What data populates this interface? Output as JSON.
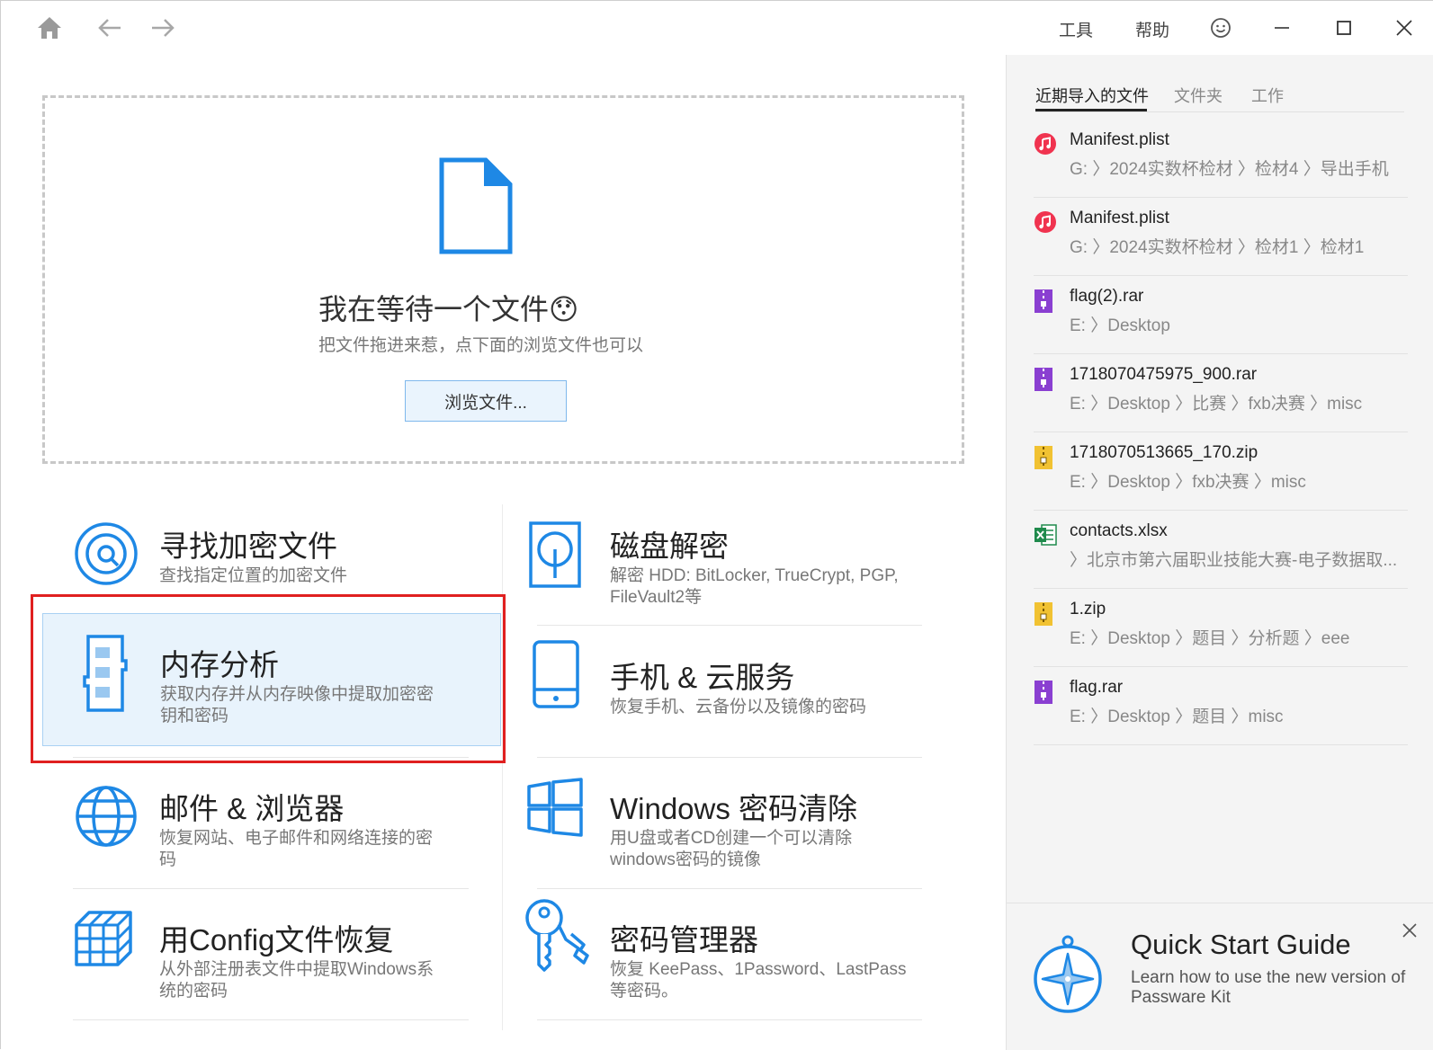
{
  "titlebar": {
    "menu_tools": "工具",
    "menu_help": "帮助"
  },
  "dropzone": {
    "title": "我在等待一个文件😯",
    "subtitle": "把文件拖进来惹，点下面的浏览文件也可以",
    "browse_button": "浏览文件..."
  },
  "tiles": [
    {
      "title": "寻找加密文件",
      "desc": "查找指定位置的加密文件",
      "icon": "disc-search-icon"
    },
    {
      "title": "磁盘解密",
      "desc": "解密 HDD: BitLocker, TrueCrypt, PGP, FileVault2等",
      "icon": "disk-icon"
    },
    {
      "title": "内存分析",
      "desc": "获取内存并从内存映像中提取加密密钥和密码",
      "icon": "memory-icon",
      "selected": true
    },
    {
      "title": "手机 & 云服务",
      "desc": "恢复手机、云备份以及镜像的密码",
      "icon": "phone-icon"
    },
    {
      "title": "邮件 & 浏览器",
      "desc": "恢复网站、电子邮件和网络连接的密码",
      "icon": "globe-icon"
    },
    {
      "title": "Windows 密码清除",
      "desc": "用U盘或者CD创建一个可以清除windows密码的镜像",
      "icon": "windows-icon"
    },
    {
      "title": "用Config文件恢复",
      "desc": "从外部注册表文件中提取Windows系统的密码",
      "icon": "cubes-icon"
    },
    {
      "title": "密码管理器",
      "desc": "恢复 KeePass、1Password、LastPass 等密码。",
      "icon": "keys-icon"
    }
  ],
  "sidebar": {
    "tabs": [
      "近期导入的文件",
      "文件夹",
      "工作"
    ],
    "files": [
      {
        "name": "Manifest.plist",
        "path": "G: 〉2024实数杯检材 〉检材4 〉导出手机",
        "icon": "music-icon",
        "color": "#f0334f"
      },
      {
        "name": "Manifest.plist",
        "path": "G: 〉2024实数杯检材 〉检材1 〉检材1",
        "icon": "music-icon",
        "color": "#f0334f"
      },
      {
        "name": "flag(2).rar",
        "path": "E: 〉Desktop",
        "icon": "rar-icon",
        "color": "#8a3fd1"
      },
      {
        "name": "1718070475975_900.rar",
        "path": "E: 〉Desktop 〉比赛 〉fxb决赛 〉misc",
        "icon": "rar-icon",
        "color": "#8a3fd1"
      },
      {
        "name": "1718070513665_170.zip",
        "path": "E: 〉Desktop 〉fxb决赛 〉misc",
        "icon": "zip-icon",
        "color": "#f1c232"
      },
      {
        "name": "contacts.xlsx",
        "path": "〉北京市第六届职业技能大赛-电子数据取...",
        "icon": "excel-icon",
        "color": "#1f8a4c"
      },
      {
        "name": "1.zip",
        "path": "E: 〉Desktop 〉题目 〉分析题 〉eee",
        "icon": "zip-icon",
        "color": "#f1c232"
      },
      {
        "name": "flag.rar",
        "path": "E: 〉Desktop 〉题目 〉misc",
        "icon": "rar-icon",
        "color": "#8a3fd1"
      }
    ],
    "quickstart": {
      "title": "Quick Start Guide",
      "desc": "Learn how to use the new version of Passware Kit"
    }
  },
  "colors": {
    "accent": "#1e88e5",
    "selected_bg": "#e8f3fc",
    "highlight_box": "#e02020"
  }
}
